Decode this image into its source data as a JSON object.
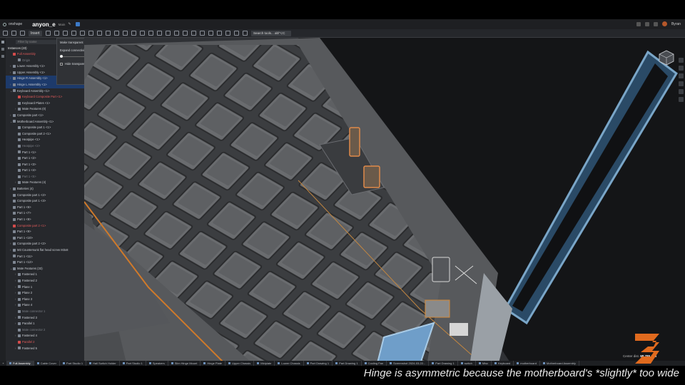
{
  "app": {
    "brand": "onshape",
    "document_name": "anyon_e",
    "branch": "Main",
    "user": "Byran"
  },
  "toolbar": {
    "insert_label": "Insert",
    "search_label": "Search tools... alt/⌥C"
  },
  "tree": {
    "filter_placeholder": "Filter by name",
    "instances_header": "Instances (23)",
    "items": [
      {
        "label": "Full Assembly",
        "indent": 0,
        "style": "red",
        "twisty": ""
      },
      {
        "label": "Origin",
        "indent": 1,
        "style": "dim",
        "twisty": ""
      },
      {
        "label": "Lower Assembly <1>",
        "indent": 0,
        "style": "",
        "twisty": "›"
      },
      {
        "label": "Upper Assembly <1>",
        "indent": 0,
        "style": "",
        "twisty": "›"
      },
      {
        "label": "Hinge R Assembly <1>",
        "indent": 0,
        "style": "sel",
        "twisty": "›"
      },
      {
        "label": "Hinge L Assembly <1>",
        "indent": 0,
        "style": "sel",
        "twisty": "›"
      },
      {
        "label": "Keyboard Assembly <1>",
        "indent": 0,
        "style": "",
        "twisty": "⌄"
      },
      {
        "label": "Keyboard Composite Part <1>",
        "indent": 1,
        "style": "red",
        "twisty": ""
      },
      {
        "label": "Keyboard Plates <1>",
        "indent": 1,
        "style": "",
        "twisty": ""
      },
      {
        "label": "Mate Features (0)",
        "indent": 1,
        "style": "",
        "twisty": "›"
      },
      {
        "label": "Composite part <1>",
        "indent": 0,
        "style": "",
        "twisty": "›"
      },
      {
        "label": "Motherboard Assembly <1>",
        "indent": 0,
        "style": "",
        "twisty": "⌄"
      },
      {
        "label": "Composite part 1 <1>",
        "indent": 1,
        "style": "",
        "twisty": ""
      },
      {
        "label": "Composite part 2 <1>",
        "indent": 1,
        "style": "",
        "twisty": ""
      },
      {
        "label": "Heatpipe <1>",
        "indent": 1,
        "style": "",
        "twisty": ""
      },
      {
        "label": "Heatpipe <2>",
        "indent": 1,
        "style": "dim",
        "twisty": ""
      },
      {
        "label": "Part 1 <1>",
        "indent": 1,
        "style": "",
        "twisty": ""
      },
      {
        "label": "Part 1 <2>",
        "indent": 1,
        "style": "",
        "twisty": ""
      },
      {
        "label": "Part 1 <3>",
        "indent": 1,
        "style": "",
        "twisty": ""
      },
      {
        "label": "Part 1 <4>",
        "indent": 1,
        "style": "",
        "twisty": ""
      },
      {
        "label": "Part 1 <5>",
        "indent": 1,
        "style": "dim",
        "twisty": ""
      },
      {
        "label": "Mate Features (4)",
        "indent": 1,
        "style": "",
        "twisty": "›"
      },
      {
        "label": "Batteries (4)",
        "indent": 0,
        "style": "",
        "twisty": "›"
      },
      {
        "label": "Composite part 1 <2>",
        "indent": 0,
        "style": "",
        "twisty": ""
      },
      {
        "label": "Composite part 1 <3>",
        "indent": 0,
        "style": "",
        "twisty": ""
      },
      {
        "label": "Part 1 <6>",
        "indent": 0,
        "style": "",
        "twisty": ""
      },
      {
        "label": "Part 1 <7>",
        "indent": 0,
        "style": "",
        "twisty": ""
      },
      {
        "label": "Part 1 <8>",
        "indent": 0,
        "style": "",
        "twisty": ""
      },
      {
        "label": "Composite part 2 <1>",
        "indent": 0,
        "style": "red",
        "twisty": ""
      },
      {
        "label": "Part 1 <9>",
        "indent": 0,
        "style": "",
        "twisty": ""
      },
      {
        "label": "Part 1 <10>",
        "indent": 0,
        "style": "",
        "twisty": ""
      },
      {
        "label": "Composite part 2 <2>",
        "indent": 0,
        "style": "",
        "twisty": "›"
      },
      {
        "label": "M3 Countersunk flat head screw M3x8",
        "indent": 0,
        "style": "",
        "twisty": "›"
      },
      {
        "label": "Part 1 <11>",
        "indent": 0,
        "style": "",
        "twisty": ""
      },
      {
        "label": "Part 1 <12>",
        "indent": 0,
        "style": "",
        "twisty": ""
      },
      {
        "label": "Mate Features (33)",
        "indent": 0,
        "style": "",
        "twisty": "⌄"
      },
      {
        "label": "Fastened 1",
        "indent": 1,
        "style": "",
        "twisty": "›"
      },
      {
        "label": "Fastened 2",
        "indent": 1,
        "style": "",
        "twisty": "›"
      },
      {
        "label": "Plane 1",
        "indent": 1,
        "style": "",
        "twisty": "›"
      },
      {
        "label": "Plane 2",
        "indent": 1,
        "style": "",
        "twisty": "›"
      },
      {
        "label": "Plane 3",
        "indent": 1,
        "style": "",
        "twisty": "›"
      },
      {
        "label": "Plane 4",
        "indent": 1,
        "style": "",
        "twisty": "›"
      },
      {
        "label": "Mate connector 1",
        "indent": 1,
        "style": "dim",
        "twisty": ""
      },
      {
        "label": "Fastened 3",
        "indent": 1,
        "style": "",
        "twisty": "›"
      },
      {
        "label": "Parallel 1",
        "indent": 1,
        "style": "",
        "twisty": "›"
      },
      {
        "label": "Mate connector 2",
        "indent": 1,
        "style": "dim",
        "twisty": ""
      },
      {
        "label": "Fastened 4",
        "indent": 1,
        "style": "",
        "twisty": "›"
      },
      {
        "label": "Parallel 2",
        "indent": 1,
        "style": "red",
        "twisty": ""
      },
      {
        "label": "Fastened 5",
        "indent": 1,
        "style": "",
        "twisty": "›"
      }
    ]
  },
  "popup": {
    "title": "Make transparent",
    "expand_label": "Expand connectivity",
    "expand_value": "1",
    "hide_label": "Hide transparent parts"
  },
  "viewport": {
    "units_label": "Center dist.",
    "units_value": "98.789 mm"
  },
  "tabs": [
    {
      "label": "Full Assembly",
      "active": true
    },
    {
      "label": "Cable Cover",
      "active": false
    },
    {
      "label": "Part Studio 1",
      "active": false
    },
    {
      "label": "Hall Switch Holder",
      "active": false
    },
    {
      "label": "Part Studio 1",
      "active": false
    },
    {
      "label": "Speakers",
      "active": false
    },
    {
      "label": "Slim Hinge Mount",
      "active": false
    },
    {
      "label": "Hinge Plate",
      "active": false
    },
    {
      "label": "Upper Chassis",
      "active": false
    },
    {
      "label": "Midplate",
      "active": false
    },
    {
      "label": "Lower Chassis",
      "active": false
    },
    {
      "label": "Part Drawing 1",
      "active": false
    },
    {
      "label": "Part Drawing 1",
      "active": false
    },
    {
      "label": "Cooling Fan",
      "active": false
    },
    {
      "label": "Screenshot 2024-03-22...",
      "active": false
    },
    {
      "label": "Part Drawing 1",
      "active": false
    },
    {
      "label": "switch",
      "active": false
    },
    {
      "label": "Misc",
      "active": false
    },
    {
      "label": "Keyboard",
      "active": false
    },
    {
      "label": "motherboard",
      "active": false
    },
    {
      "label": "Motherboard Assembly",
      "active": false
    }
  ],
  "caption": "Hinge is asymmetric because the motherboard's *slightly* too wide",
  "colors": {
    "accent_orange": "#e06a1e",
    "selection_blue": "#1d3a6b",
    "panel_bg": "#26282c"
  }
}
